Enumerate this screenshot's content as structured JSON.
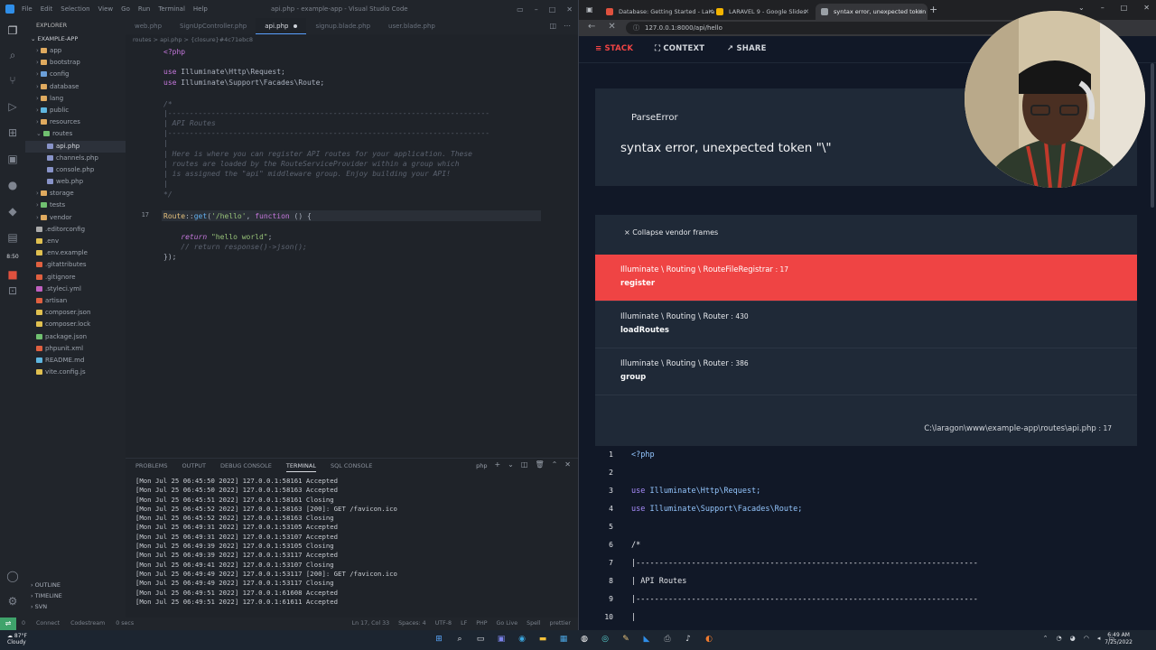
{
  "vscode": {
    "menu": [
      "File",
      "Edit",
      "Selection",
      "View",
      "Go",
      "Run",
      "Terminal",
      "Help"
    ],
    "window_title": "api.php - example-app - Visual Studio Code",
    "explorer_header": "EXPLORER",
    "project": "EXAMPLE-APP",
    "tree": [
      {
        "label": "app",
        "indent": 1,
        "kind": "folder",
        "color": "#dfaa5f"
      },
      {
        "label": "bootstrap",
        "indent": 1,
        "kind": "folder",
        "color": "#dfaa5f"
      },
      {
        "label": "config",
        "indent": 1,
        "kind": "folder",
        "color": "#6b9fd8"
      },
      {
        "label": "database",
        "indent": 1,
        "kind": "folder",
        "color": "#dfaa5f"
      },
      {
        "label": "lang",
        "indent": 1,
        "kind": "folder",
        "color": "#dfaa5f"
      },
      {
        "label": "public",
        "indent": 1,
        "kind": "folder",
        "color": "#5fb6df"
      },
      {
        "label": "resources",
        "indent": 1,
        "kind": "folder",
        "color": "#dfaa5f"
      },
      {
        "label": "routes",
        "indent": 1,
        "kind": "folder",
        "color": "#70c070"
      },
      {
        "label": "api.php",
        "indent": 2,
        "kind": "file",
        "color": "#8893c8",
        "active": true
      },
      {
        "label": "channels.php",
        "indent": 2,
        "kind": "file",
        "color": "#8893c8"
      },
      {
        "label": "console.php",
        "indent": 2,
        "kind": "file",
        "color": "#8893c8"
      },
      {
        "label": "web.php",
        "indent": 2,
        "kind": "file",
        "color": "#8893c8"
      },
      {
        "label": "storage",
        "indent": 1,
        "kind": "folder",
        "color": "#dfaa5f"
      },
      {
        "label": "tests",
        "indent": 1,
        "kind": "folder",
        "color": "#70c070"
      },
      {
        "label": "vendor",
        "indent": 1,
        "kind": "folder",
        "color": "#dfaa5f"
      },
      {
        "label": ".editorconfig",
        "indent": 1,
        "kind": "file",
        "color": "#aaaaaa"
      },
      {
        "label": ".env",
        "indent": 1,
        "kind": "file",
        "color": "#e0c050"
      },
      {
        "label": ".env.example",
        "indent": 1,
        "kind": "file",
        "color": "#e0c050"
      },
      {
        "label": ".gitattributes",
        "indent": 1,
        "kind": "file",
        "color": "#e06040"
      },
      {
        "label": ".gitignore",
        "indent": 1,
        "kind": "file",
        "color": "#e06040"
      },
      {
        "label": ".styleci.yml",
        "indent": 1,
        "kind": "file",
        "color": "#c060c0"
      },
      {
        "label": "artisan",
        "indent": 1,
        "kind": "file",
        "color": "#e06040"
      },
      {
        "label": "composer.json",
        "indent": 1,
        "kind": "file",
        "color": "#e0c050"
      },
      {
        "label": "composer.lock",
        "indent": 1,
        "kind": "file",
        "color": "#e0c050"
      },
      {
        "label": "package.json",
        "indent": 1,
        "kind": "file",
        "color": "#70c070"
      },
      {
        "label": "phpunit.xml",
        "indent": 1,
        "kind": "file",
        "color": "#e06040"
      },
      {
        "label": "README.md",
        "indent": 1,
        "kind": "file",
        "color": "#5fb6df"
      },
      {
        "label": "vite.config.js",
        "indent": 1,
        "kind": "file",
        "color": "#e0c050"
      }
    ],
    "outline": "OUTLINE",
    "timeline": "TIMELINE",
    "svn": "SVN",
    "tabs": [
      {
        "label": "web.php",
        "active": false
      },
      {
        "label": "SignUpController.php",
        "active": false
      },
      {
        "label": "api.php",
        "active": true,
        "dirty": true
      },
      {
        "label": "signup.blade.php",
        "active": false
      },
      {
        "label": "user.blade.php",
        "active": false
      }
    ],
    "breadcrumb": "routes > api.php > {closure}#4c71ebc8",
    "code": {
      "l1": "<?php",
      "use1_kw": "use",
      "use1_ns": " Illuminate\\Http\\Request;",
      "use2_kw": "use",
      "use2_ns": " Illuminate\\Support\\Facades\\Route;",
      "c1": "/*",
      "c2": "|--------------------------------------------------------------------------",
      "c3": "| API Routes",
      "c4": "|--------------------------------------------------------------------------",
      "c5": "|",
      "c6": "| Here is where you can register API routes for your application. These",
      "c7": "| routes are loaded by the RouteServiceProvider within a group which",
      "c8": "| is assigned the \"api\" middleware group. Enjoy building your API!",
      "c9": "|",
      "c10": "*/",
      "route_cls": "Route",
      "route_sep": "::",
      "route_fn": "get",
      "route_open": "(",
      "route_str": "'/hello'",
      "route_comma": ", ",
      "route_kw": "function",
      "route_rest": " () {",
      "ret_kw": "return",
      "ret_str": " \"hello world\"",
      "ret_end": ";",
      "ret_comment": "// return response()->json();",
      "close": "});",
      "line_number": "17"
    },
    "panel_tabs": [
      "PROBLEMS",
      "OUTPUT",
      "DEBUG CONSOLE",
      "TERMINAL",
      "SQL CONSOLE"
    ],
    "panel_active": "TERMINAL",
    "terminal_shell": "php",
    "terminal": [
      "[Mon Jul 25 06:45:50 2022] 127.0.0.1:58161 Accepted",
      "[Mon Jul 25 06:45:50 2022] 127.0.0.1:58163 Accepted",
      "[Mon Jul 25 06:45:51 2022] 127.0.0.1:58161 Closing",
      "[Mon Jul 25 06:45:52 2022] 127.0.0.1:58163 [200]: GET /favicon.ico",
      "[Mon Jul 25 06:45:52 2022] 127.0.0.1:58163 Closing",
      "[Mon Jul 25 06:49:31 2022] 127.0.0.1:53105 Accepted",
      "[Mon Jul 25 06:49:31 2022] 127.0.0.1:53107 Accepted",
      "[Mon Jul 25 06:49:39 2022] 127.0.0.1:53105 Closing",
      "[Mon Jul 25 06:49:39 2022] 127.0.0.1:53117 Accepted",
      "[Mon Jul 25 06:49:41 2022] 127.0.0.1:53107 Closing",
      "[Mon Jul 25 06:49:49 2022] 127.0.0.1:53117 [200]: GET /favicon.ico",
      "[Mon Jul 25 06:49:49 2022] 127.0.0.1:53117 Closing",
      "[Mon Jul 25 06:49:51 2022] 127.0.0.1:61608 Accepted",
      "[Mon Jul 25 06:49:51 2022] 127.0.0.1:61611 Accepted"
    ],
    "status_left": [
      "0",
      "Connect",
      "Codestream",
      "0 secs"
    ],
    "status_right": [
      "Ln 17, Col 33",
      "Spaces: 4",
      "UTF-8",
      "LF",
      "PHP",
      "Go Live",
      "Spell",
      "prettier"
    ],
    "clock_badge": "8:50"
  },
  "browser": {
    "tabs": [
      {
        "label": "Database: Getting Started - Lara",
        "color": "#e0513e"
      },
      {
        "label": "LARAVEL 9 - Google Slides",
        "color": "#f4b400"
      },
      {
        "label": "syntax error, unexpected token",
        "color": "#9aa0a6",
        "active": true
      }
    ],
    "url": "127.0.0.1:8000/api/hello",
    "ignition_tabs": [
      "STACK",
      "CONTEXT",
      "SHARE"
    ],
    "error_type": "ParseError",
    "error_message": "syntax error, unexpected token \"\\\"",
    "collapse_label": "Collapse vendor frames",
    "frames": [
      {
        "class": "Illuminate \\ Routing \\ RouteFileRegistrar",
        "line": ": 17",
        "method": "register",
        "active": true
      },
      {
        "class": "Illuminate \\ Routing \\ Router",
        "line": ": 430",
        "method": "loadRoutes"
      },
      {
        "class": "Illuminate \\ Routing \\ Router",
        "line": ": 386",
        "method": "group"
      }
    ],
    "source_path": "C:\\laragon\\www\\example-app\\routes\\api.php",
    "source_line": ": 17",
    "source_lines": [
      {
        "n": "1",
        "text": "<?php",
        "cls": "v-c"
      },
      {
        "n": "2",
        "text": "",
        "cls": "v-p"
      },
      {
        "n": "3",
        "kw": "use",
        "text": " Illuminate\\Http\\Request;",
        "cls": "v-c"
      },
      {
        "n": "4",
        "kw": "use",
        "text": " Illuminate\\Support\\Facades\\Route;",
        "cls": "v-c"
      },
      {
        "n": "5",
        "text": "",
        "cls": "v-p"
      },
      {
        "n": "6",
        "text": "/*",
        "cls": "v-p"
      },
      {
        "n": "7",
        "text": "|--------------------------------------------------------------------------",
        "cls": "v-p"
      },
      {
        "n": "8",
        "text": "| API Routes",
        "cls": "v-p"
      },
      {
        "n": "9",
        "text": "|--------------------------------------------------------------------------",
        "cls": "v-p"
      },
      {
        "n": "10",
        "text": "|",
        "cls": "v-p"
      }
    ]
  },
  "taskbar": {
    "temp": "87°F",
    "weather": "Cloudy",
    "time": "6:49 AM",
    "date": "7/25/2022"
  }
}
